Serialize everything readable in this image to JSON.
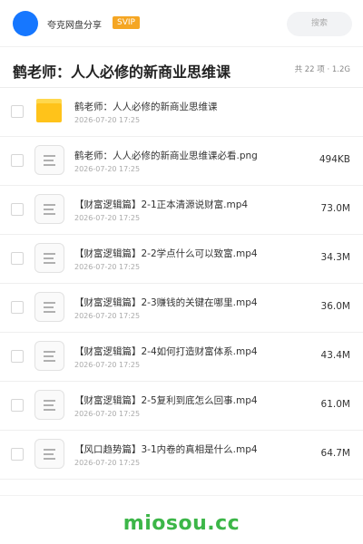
{
  "header": {
    "share_title": "夸克网盘分享",
    "badge": "SVIP",
    "search_placeholder": "搜索"
  },
  "folder": {
    "title": "鹤老师：人人必修的新商业思维课",
    "meta": "共 22 项 · 1.2G"
  },
  "files": [
    {
      "type": "folder",
      "icon": "folder-icon",
      "name": "鹤老师：人人必修的新商业思维课",
      "date": "2026-07-20 17:25",
      "size": ""
    },
    {
      "type": "file",
      "icon": "file-icon",
      "name": "鹤老师：人人必修的新商业思维课必看.png",
      "date": "2026-07-20 17:25",
      "size": "494KB"
    },
    {
      "type": "file",
      "icon": "file-icon",
      "name": "【财富逻辑篇】2-1正本清源说财富.mp4",
      "date": "2026-07-20 17:25",
      "size": "73.0M"
    },
    {
      "type": "file",
      "icon": "file-icon",
      "name": "【财富逻辑篇】2-2学点什么可以致富.mp4",
      "date": "2026-07-20 17:25",
      "size": "34.3M"
    },
    {
      "type": "file",
      "icon": "file-icon",
      "name": "【财富逻辑篇】2-3赚钱的关键在哪里.mp4",
      "date": "2026-07-20 17:25",
      "size": "36.0M"
    },
    {
      "type": "file",
      "icon": "file-icon",
      "name": "【财富逻辑篇】2-4如何打造财富体系.mp4",
      "date": "2026-07-20 17:25",
      "size": "43.4M"
    },
    {
      "type": "file",
      "icon": "file-icon",
      "name": "【财富逻辑篇】2-5复利到底怎么回事.mp4",
      "date": "2026-07-20 17:25",
      "size": "61.0M"
    },
    {
      "type": "file",
      "icon": "file-icon",
      "name": "【风口趋势篇】3-1内卷的真相是什么.mp4",
      "date": "2026-07-20 17:25",
      "size": "64.7M"
    }
  ],
  "watermark": "miosou.cc",
  "colors": {
    "accent": "#1677ff",
    "badge": "#f5a623",
    "folder": "#ffc31a",
    "watermark": "#3cb648"
  }
}
